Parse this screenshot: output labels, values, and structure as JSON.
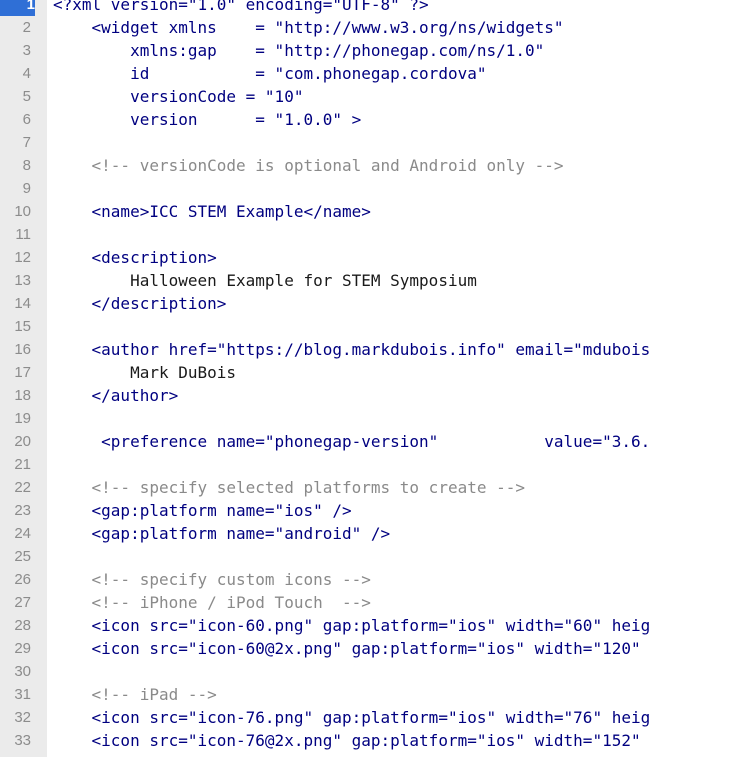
{
  "editor": {
    "active_line": 1,
    "colors": {
      "tag": "#000080",
      "text": "#1a1a1a",
      "comment": "#8a8a8a",
      "gutter": "#ebebeb",
      "active_line_number": "#2f6fd6"
    },
    "lines": [
      {
        "n": "1",
        "kind": "tag",
        "text": "<?xml version=\"1.0\" encoding=\"UTF-8\" ?>"
      },
      {
        "n": "2",
        "kind": "tag",
        "text": "    <widget xmlns    = \"http://www.w3.org/ns/widgets\""
      },
      {
        "n": "3",
        "kind": "tag",
        "text": "        xmlns:gap    = \"http://phonegap.com/ns/1.0\""
      },
      {
        "n": "4",
        "kind": "tag",
        "text": "        id           = \"com.phonegap.cordova\""
      },
      {
        "n": "5",
        "kind": "tag",
        "text": "        versionCode = \"10\""
      },
      {
        "n": "6",
        "kind": "tag",
        "text": "        version      = \"1.0.0\" >"
      },
      {
        "n": "7",
        "kind": "plain",
        "text": ""
      },
      {
        "n": "8",
        "kind": "comment",
        "text": "    <!-- versionCode is optional and Android only -->"
      },
      {
        "n": "9",
        "kind": "plain",
        "text": ""
      },
      {
        "n": "10",
        "kind": "tag",
        "text": "    <name>ICC STEM Example</name>"
      },
      {
        "n": "11",
        "kind": "plain",
        "text": ""
      },
      {
        "n": "12",
        "kind": "tag",
        "text": "    <description>"
      },
      {
        "n": "13",
        "kind": "plain",
        "text": "        Halloween Example for STEM Symposium"
      },
      {
        "n": "14",
        "kind": "tag",
        "text": "    </description>"
      },
      {
        "n": "15",
        "kind": "plain",
        "text": ""
      },
      {
        "n": "16",
        "kind": "tag",
        "text": "    <author href=\"https://blog.markdubois.info\" email=\"mdubois"
      },
      {
        "n": "17",
        "kind": "plain",
        "text": "        Mark DuBois"
      },
      {
        "n": "18",
        "kind": "tag",
        "text": "    </author>"
      },
      {
        "n": "19",
        "kind": "plain",
        "text": ""
      },
      {
        "n": "20",
        "kind": "tag",
        "text": "     <preference name=\"phonegap-version\"           value=\"3.6."
      },
      {
        "n": "21",
        "kind": "plain",
        "text": ""
      },
      {
        "n": "22",
        "kind": "comment",
        "text": "    <!-- specify selected platforms to create -->"
      },
      {
        "n": "23",
        "kind": "tag",
        "text": "    <gap:platform name=\"ios\" />"
      },
      {
        "n": "24",
        "kind": "tag",
        "text": "    <gap:platform name=\"android\" />"
      },
      {
        "n": "25",
        "kind": "plain",
        "text": ""
      },
      {
        "n": "26",
        "kind": "comment",
        "text": "    <!-- specify custom icons -->"
      },
      {
        "n": "27",
        "kind": "comment",
        "text": "    <!-- iPhone / iPod Touch  -->"
      },
      {
        "n": "28",
        "kind": "tag",
        "text": "    <icon src=\"icon-60.png\" gap:platform=\"ios\" width=\"60\" heig"
      },
      {
        "n": "29",
        "kind": "tag",
        "text": "    <icon src=\"icon-60@2x.png\" gap:platform=\"ios\" width=\"120\""
      },
      {
        "n": "30",
        "kind": "plain",
        "text": ""
      },
      {
        "n": "31",
        "kind": "comment",
        "text": "    <!-- iPad -->"
      },
      {
        "n": "32",
        "kind": "tag",
        "text": "    <icon src=\"icon-76.png\" gap:platform=\"ios\" width=\"76\" heig"
      },
      {
        "n": "33",
        "kind": "tag",
        "text": "    <icon src=\"icon-76@2x.png\" gap:platform=\"ios\" width=\"152\""
      }
    ]
  }
}
